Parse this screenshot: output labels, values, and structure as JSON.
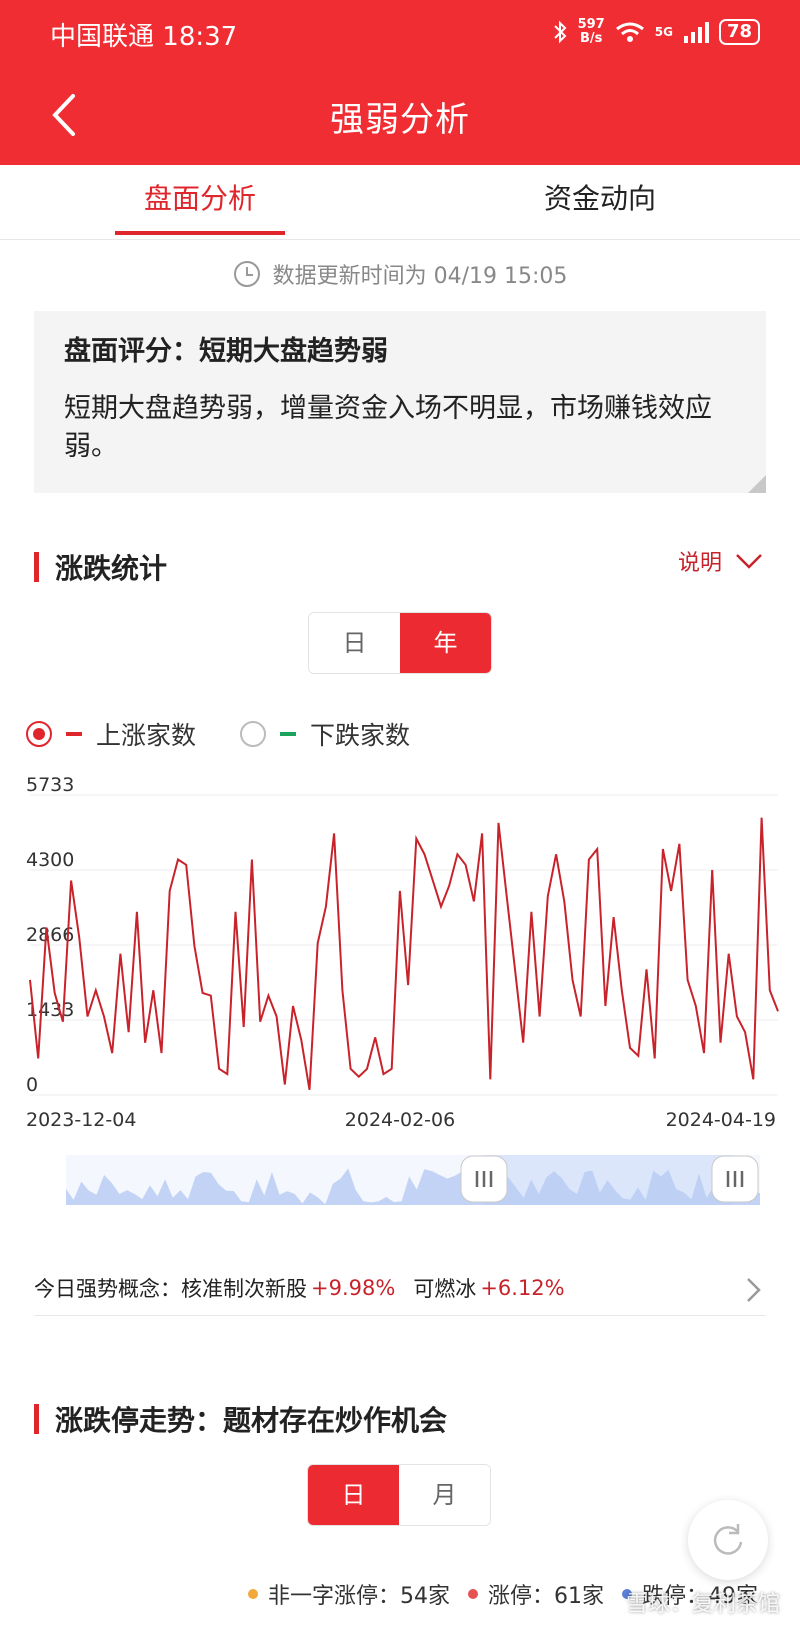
{
  "status": {
    "carrier": "中国联通",
    "time": "18:37",
    "netspeed_top": "597",
    "netspeed_bottom": "B/s",
    "network": "5G",
    "battery": "78"
  },
  "header": {
    "title": "强弱分析"
  },
  "tabs": [
    {
      "label": "盘面分析",
      "active": true
    },
    {
      "label": "资金动向",
      "active": false
    }
  ],
  "update": {
    "label": "数据更新时间为 04/19  15:05"
  },
  "score": {
    "title": "盘面评分：短期大盘趋势弱",
    "desc": "短期大盘趋势弱，增量资金入场不明显，市场赚钱效应弱。"
  },
  "rise_fall": {
    "title": "涨跌统计",
    "explain": "说明",
    "periods": [
      "日",
      "年"
    ],
    "active_period": "年",
    "legend": [
      {
        "label": "上涨家数",
        "color": "#e0262d",
        "checked": true
      },
      {
        "label": "下跌家数",
        "color": "#1aa35b",
        "checked": false
      }
    ]
  },
  "chart_data": {
    "type": "line",
    "series": [
      {
        "name": "上涨家数",
        "color": "#c8232b",
        "values": [
          2200,
          700,
          3200,
          1950,
          1400,
          4100,
          3000,
          1500,
          2000,
          1500,
          800,
          2700,
          1200,
          3500,
          1000,
          2000,
          800,
          3900,
          4500,
          4400,
          2850,
          1950,
          1900,
          500,
          400,
          3500,
          1300,
          4500,
          1400,
          1900,
          1500,
          200,
          1700,
          1050,
          100,
          2900,
          3600,
          5000,
          2000,
          500,
          350,
          500,
          1100,
          400,
          500,
          3900,
          2100,
          4900,
          4600,
          4100,
          3600,
          4000,
          4600,
          4400,
          3700,
          5000,
          300,
          5200,
          3800,
          2400,
          1000,
          3500,
          1500,
          3800,
          4600,
          3700,
          2200,
          1500,
          4500,
          4700,
          1700,
          3400,
          2000,
          900,
          750,
          2400,
          700,
          4700,
          3900,
          4800,
          2200,
          1700,
          800,
          4300,
          1000,
          2700,
          1500,
          1200,
          300,
          5300,
          2000,
          1600
        ]
      }
    ],
    "x_ticks": [
      "2023-12-04",
      "2024-02-06",
      "2024-04-19"
    ],
    "y_ticks": [
      "0",
      "1433",
      "2866",
      "4300",
      "5733"
    ],
    "ylim": [
      0,
      5733
    ]
  },
  "concept": {
    "prefix": "今日强势概念：",
    "items": [
      {
        "name": "核准制次新股",
        "change": "+9.98%"
      },
      {
        "name": "可燃冰",
        "change": "+6.12%"
      }
    ]
  },
  "limit": {
    "title": "涨跌停走势：题材存在炒作机会",
    "periods": [
      "日",
      "月"
    ],
    "active_period": "日",
    "legend": [
      {
        "label": "非一字涨停：54家",
        "color": "#f2a93b"
      },
      {
        "label": "涨停：61家",
        "color": "#e6524f"
      },
      {
        "label": "跌停：49家",
        "color": "#5b7fd6"
      }
    ]
  },
  "watermark": "雪球：复利茶馆"
}
